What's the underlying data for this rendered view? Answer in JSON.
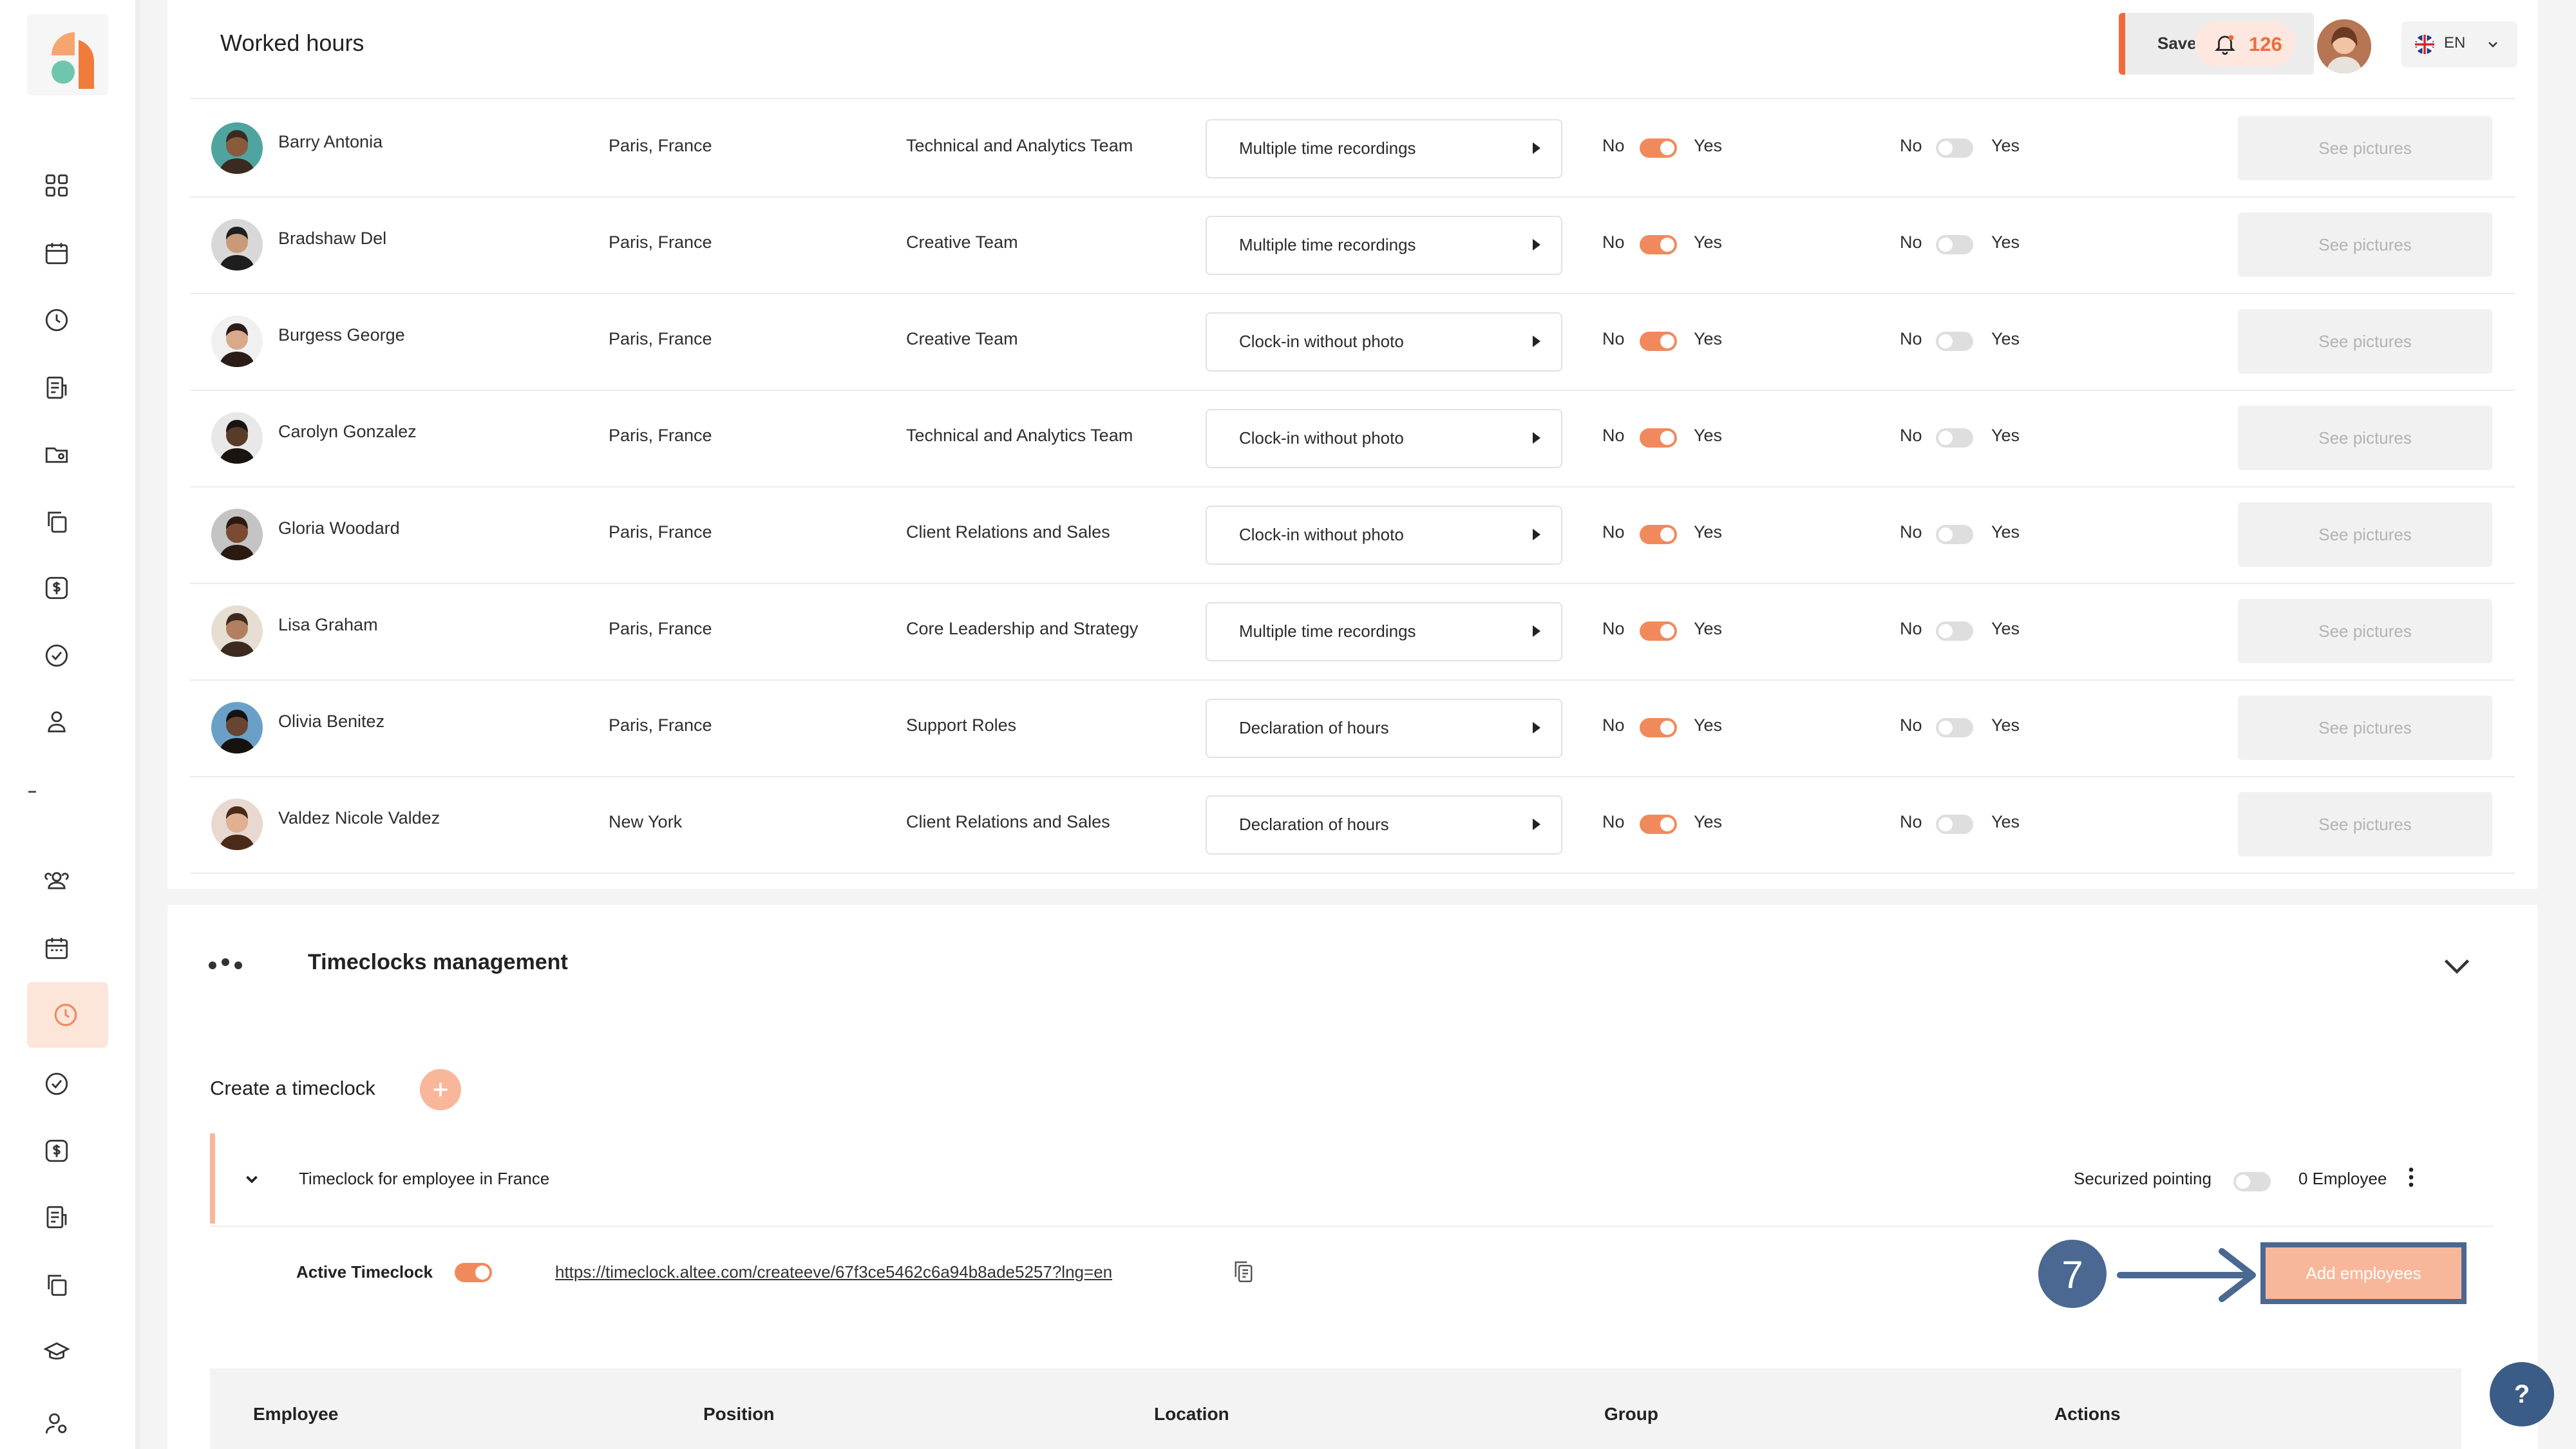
{
  "header": {
    "title": "Worked hours",
    "save_button": "Save my hours",
    "notifications_count": "126",
    "language": "EN"
  },
  "labels": {
    "no": "No",
    "yes": "Yes",
    "see_pictures": "See pictures"
  },
  "rows": [
    {
      "name": "Barry Antonia",
      "location": "Paris, France",
      "team": "Technical and Analytics Team",
      "mode": "Multiple time recordings"
    },
    {
      "name": "Bradshaw Del",
      "location": "Paris, France",
      "team": "Creative Team",
      "mode": "Multiple time recordings"
    },
    {
      "name": "Burgess George",
      "location": "Paris, France",
      "team": "Creative Team",
      "mode": "Clock-in without photo"
    },
    {
      "name": "Carolyn Gonzalez",
      "location": "Paris, France",
      "team": "Technical and Analytics Team",
      "mode": "Clock-in without photo"
    },
    {
      "name": "Gloria Woodard",
      "location": "Paris, France",
      "team": "Client Relations and Sales",
      "mode": "Clock-in without photo"
    },
    {
      "name": "Lisa Graham",
      "location": "Paris, France",
      "team": "Core Leadership and Strategy",
      "mode": "Multiple time recordings"
    },
    {
      "name": "Olivia Benitez",
      "location": "Paris, France",
      "team": "Support Roles",
      "mode": "Declaration of hours"
    },
    {
      "name": "Valdez Nicole Valdez",
      "location": "New York",
      "team": "Client Relations and Sales",
      "mode": "Declaration of hours"
    }
  ],
  "timeclocks": {
    "title": "Timeclocks management",
    "create_label": "Create a timeclock",
    "item": {
      "name": "Timeclock for employee in France",
      "securized_label": "Securized pointing",
      "employee_count": "0 Employee",
      "active_label": "Active Timeclock",
      "url": "https://timeclock.altee.com/createeve/67f3ce5462c6a94b8ade5257?lng=en",
      "add_button": "Add employees"
    },
    "table_headers": [
      "Employee",
      "Position",
      "Location",
      "Group",
      "Actions"
    ]
  },
  "annotation": {
    "step": "7"
  },
  "help": "?",
  "colors": {
    "accent": "#f08a5d",
    "annotation": "#4a6891"
  }
}
